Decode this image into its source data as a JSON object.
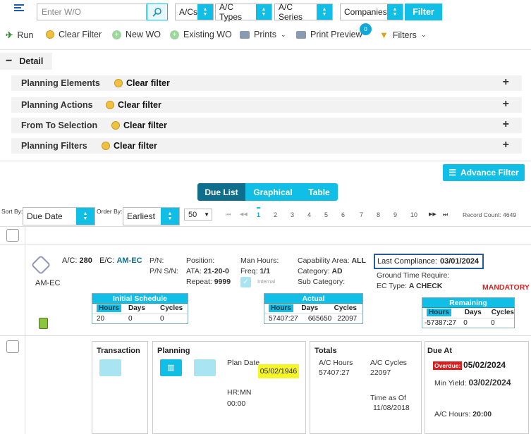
{
  "topbar": {
    "wo_placeholder": "Enter W/O",
    "acs": "A/Cs",
    "ac_types": "A/C Types",
    "ac_series": "A/C Series",
    "companies": "Companies",
    "filter": "Filter"
  },
  "toolbar": {
    "run": "Run",
    "clear_filter": "Clear Filter",
    "new_wo": "New WO",
    "existing_wo": "Existing WO",
    "prints": "Prints",
    "print_preview": "Print Preview",
    "print_preview_badge": "0",
    "filters": "Filters"
  },
  "detail": {
    "toggle": "−",
    "title": "Detail",
    "sections": [
      {
        "title": "Planning Elements",
        "clear": "Clear filter"
      },
      {
        "title": "Planning Actions",
        "clear": "Clear filter"
      },
      {
        "title": "From To Selection",
        "clear": "Clear filter"
      },
      {
        "title": "Planning Filters",
        "clear": "Clear filter"
      }
    ],
    "plus": "+"
  },
  "advance_filter": "Advance Filter",
  "view_tabs": [
    "Due List",
    "Graphical",
    "Table"
  ],
  "sort": {
    "sort_by_label": "Sort By:",
    "sort_by_value": "Due Date",
    "order_by_label": "Order By:",
    "order_by_value": "Earliest",
    "page_size": "50"
  },
  "pagination": {
    "first": "⏮",
    "prev": "◀◀",
    "pages": [
      "1",
      "2",
      "3",
      "4",
      "5",
      "6",
      "7",
      "8",
      "9",
      "10"
    ],
    "next": "▶▶",
    "last": "⏭",
    "record_count": "Record Count: 4649"
  },
  "record": {
    "ac_label": "A/C:",
    "ac_value": "280",
    "ec_label": "E/C:",
    "ec_value": "AM-EC",
    "am_ec": "AM-EC",
    "pn_label": "P/N:",
    "pnsn_label": "P/N S/N:",
    "position_label": "Position:",
    "ata_label": "ATA:",
    "ata_value": "21-20-0",
    "repeat_label": "Repeat:",
    "repeat_value": "9999",
    "man_hours_label": "Man Hours:",
    "freq_label": "Freq:",
    "freq_value": "1/1",
    "internal": "Internal",
    "capability_label": "Capability Area:",
    "capability_value": "ALL",
    "category_label": "Category:",
    "category_value": "AD",
    "sub_category_label": "Sub Category:",
    "last_compliance_label": "Last Compliance:",
    "last_compliance_value": "03/01/2024",
    "ground_time": "Ground Time Require:",
    "ec_type_label": "EC Type:",
    "ec_type_value": "A CHECK",
    "mandatory": "MANDATORY",
    "initial_schedule": {
      "title": "Initial Schedule",
      "cols": [
        "Hours",
        "Days",
        "Cycles"
      ],
      "vals": [
        "20",
        "0",
        "0"
      ]
    },
    "actual": {
      "title": "Actual",
      "cols": [
        "Hours",
        "Days",
        "Cycles"
      ],
      "vals": [
        "57407:27",
        "665650",
        "22097"
      ]
    },
    "remaining": {
      "title": "Remaining",
      "cols": [
        "Hours",
        "Days",
        "Cycles"
      ],
      "vals": [
        "-57387:27",
        "0",
        "0"
      ]
    }
  },
  "panels": {
    "transaction": "Transaction",
    "planning": "Planning",
    "plan_date_label": "Plan Date",
    "plan_date_value": "05/02/1946",
    "hrmn_label": "HR:MN",
    "hrmn_value": "00:00",
    "totals": "Totals",
    "ac_hours_label": "A/C Hours",
    "ac_hours_value": "57407:27",
    "ac_cycles_label": "A/C Cycles",
    "ac_cycles_value": "22097",
    "time_as_of_label": "Time as Of",
    "time_as_of_value": "11/08/2018",
    "due_at": "Due At",
    "overdue": "Overdue:",
    "overdue_date": "05/02/2024",
    "min_yield_label": "Min Yield:",
    "min_yield_value": "03/02/2024",
    "ac_hours_due_label": "A/C Hours:",
    "ac_hours_due_value": "20:00"
  }
}
